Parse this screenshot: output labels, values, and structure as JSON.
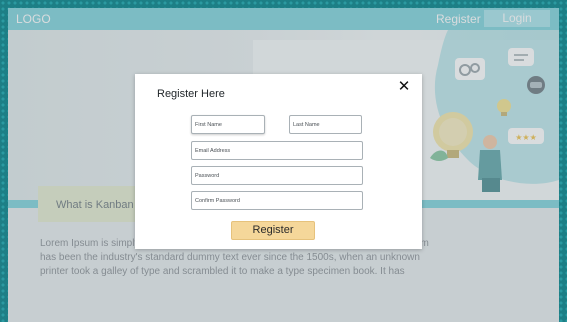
{
  "header": {
    "logo": "LOGO",
    "nav": {
      "register": "Register",
      "login": "Login"
    }
  },
  "section": {
    "title": "What is Kanban",
    "body_lines": [
      "Lorem Ipsum is simply dummy text of the printing and typesetting industry. Lorem Ipsum",
      "has been the industry's standard dummy text ever since the 1500s, when an unknown",
      "printer took a galley of type and scrambled it to make a type specimen book. It has"
    ]
  },
  "modal": {
    "title": "Register Here",
    "fields": {
      "first_name": {
        "placeholder": "First Name",
        "value": ""
      },
      "last_name": {
        "placeholder": "Last Name",
        "value": ""
      },
      "email": {
        "placeholder": "Email Address",
        "value": ""
      },
      "password": {
        "placeholder": "Password",
        "value": ""
      },
      "confirm_password": {
        "placeholder": "Confirm Password",
        "value": ""
      }
    },
    "submit_label": "Register"
  },
  "icons": {
    "close": "close-icon"
  },
  "colors": {
    "topbar": "#7fd3db",
    "button": "#f5d79a",
    "background_pattern": "#1d7f86"
  }
}
